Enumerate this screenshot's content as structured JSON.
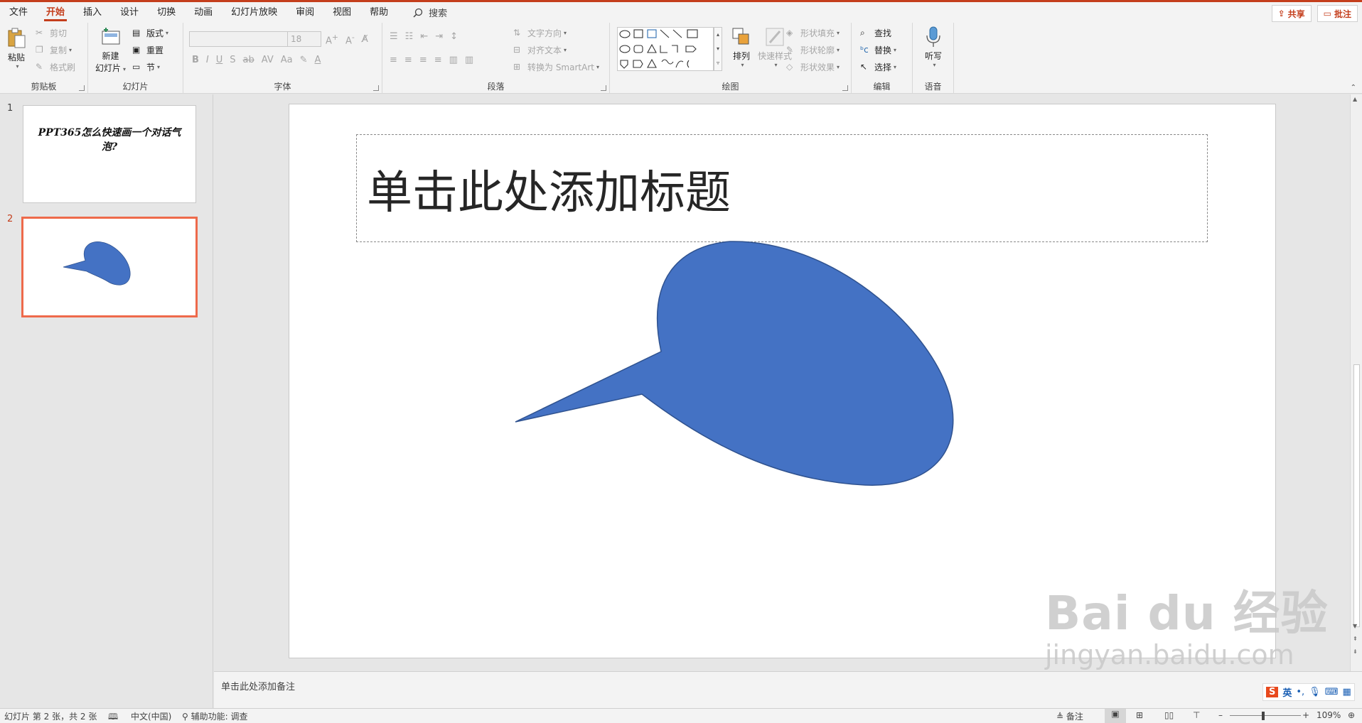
{
  "menu": {
    "items": [
      "文件",
      "开始",
      "插入",
      "设计",
      "切换",
      "动画",
      "幻灯片放映",
      "审阅",
      "视图",
      "帮助"
    ],
    "active_index": 1,
    "search_label": "搜索",
    "share_label": "共享",
    "comment_label": "批注"
  },
  "ribbon": {
    "clipboard": {
      "label": "剪贴板",
      "paste": "粘贴",
      "cut": "剪切",
      "copy": "复制",
      "format_painter": "格式刷"
    },
    "slides": {
      "label": "幻灯片",
      "new_slide_line1": "新建",
      "new_slide_line2": "幻灯片",
      "layout": "版式",
      "reset": "重置",
      "section": "节"
    },
    "font": {
      "label": "字体",
      "font_size": "18"
    },
    "paragraph": {
      "label": "段落",
      "text_direction": "文字方向",
      "align_text": "对齐文本",
      "smartart": "转换为 SmartArt"
    },
    "drawing": {
      "label": "绘图",
      "arrange": "排列",
      "quick_styles": "快速样式",
      "shape_fill": "形状填充",
      "shape_outline": "形状轮廓",
      "shape_effects": "形状效果"
    },
    "editing": {
      "label": "编辑",
      "find": "查找",
      "replace": "替换",
      "select": "选择"
    },
    "voice": {
      "label": "语音",
      "dictate": "听写"
    }
  },
  "thumbnails": [
    {
      "number": "1",
      "text": "PPT365怎么快速画一个对话气泡?"
    },
    {
      "number": "2",
      "text": ""
    }
  ],
  "slide": {
    "title_placeholder": "单击此处添加标题",
    "shape_color": "#4472c4",
    "shape_outline": "#2f528f"
  },
  "notes": {
    "placeholder": "单击此处添加备注"
  },
  "status": {
    "slide_info": "幻灯片 第 2 张，共 2 张",
    "language": "中文(中国)",
    "accessibility": "辅助功能: 调查",
    "notes_button": "备注",
    "zoom": "109%"
  },
  "ime": {
    "lang": "英"
  },
  "watermark": {
    "logo": "Bai du 经验",
    "url": "jingyan.baidu.com"
  }
}
